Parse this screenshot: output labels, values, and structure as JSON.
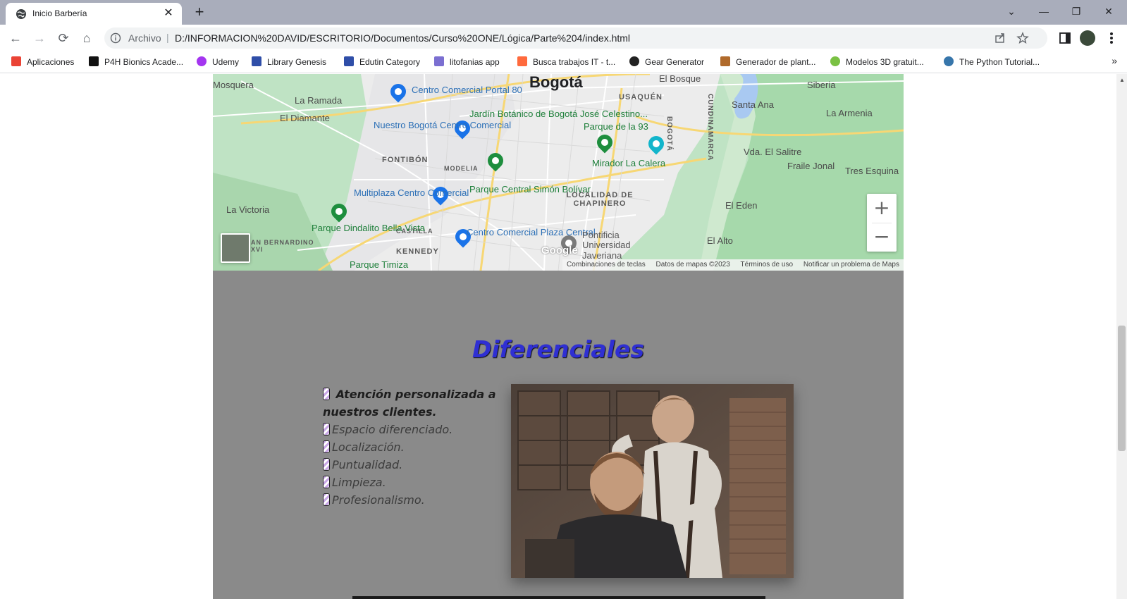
{
  "browser": {
    "tab_title": "Inicio Barbería",
    "tab_close": "✕",
    "new_tab": "+",
    "window_controls": {
      "list_tabs": "⌄",
      "minimize": "—",
      "restore": "❐",
      "close": "✕"
    },
    "nav": {
      "back": "←",
      "forward": "→",
      "reload": "⟳",
      "home": "⌂"
    },
    "address": {
      "scheme_label": "Archivo",
      "separator": "|",
      "url": "D:/INFORMACION%20DAVID/ESCRITORIO/Documentos/Curso%20ONE/Lógica/Parte%204/index.html"
    },
    "bookmarks": [
      {
        "label": "Aplicaciones",
        "icon": "apps-grid-icon",
        "color": "#ea4335"
      },
      {
        "label": "P4H Bionics Acade...",
        "icon": "p4h-icon",
        "color": "#111111"
      },
      {
        "label": "Udemy",
        "icon": "udemy-icon",
        "color": "#a435f0"
      },
      {
        "label": "Library Genesis",
        "icon": "library-icon",
        "color": "#2f4ea8"
      },
      {
        "label": "Edutin Category",
        "icon": "edutin-icon",
        "color": "#2f4ea8"
      },
      {
        "label": "litofanias app",
        "icon": "litofanias-icon",
        "color": "#7b6fd1"
      },
      {
        "label": "Busca trabajos IT - t...",
        "icon": "jobs-icon",
        "color": "#ff6a3d"
      },
      {
        "label": "Gear Generator",
        "icon": "gear-icon",
        "color": "#222222"
      },
      {
        "label": "Generador de plant...",
        "icon": "template-icon",
        "color": "#b06a2b"
      },
      {
        "label": "Modelos 3D gratuit...",
        "icon": "model3d-icon",
        "color": "#7ac143"
      },
      {
        "label": "The Python Tutorial...",
        "icon": "python-icon",
        "color": "#3776ab"
      }
    ],
    "bookmarks_more": "»"
  },
  "map": {
    "city": "Bogotá",
    "labels": {
      "mosquera": "Mosquera",
      "la_ramada": "La Ramada",
      "el_diamante": "El Diamante",
      "fontibon": "FONTIBÓN",
      "modelia": "MODELIA",
      "la_victoria": "La Victoria",
      "san_bernardino": "AN BERNARDINO XVI",
      "castilla": "CASTILLA",
      "kennedy": "KENNEDY",
      "parque_timiza": "Parque Timiza",
      "usaquen": "USAQUÉN",
      "el_bosque": "El Bosque",
      "siberia": "Siberia",
      "santa_ana": "Santa Ana",
      "la_armenia": "La Armenia",
      "vda_el_salitre": "Vda. El Salitre",
      "fraile_jonal": "Fraile Jonal",
      "tres_esquinas": "Tres Esquina",
      "el_eden": "El Eden",
      "el_alto": "El Alto",
      "bogota_vertical": "BOGOTÁ",
      "cundinamarca": "CUNDINAMARCA",
      "localidad": "LOCALIDAD DE CHAPINERO",
      "bogota_top": "Bogotá"
    },
    "pois": {
      "portal80": "Centro Comercial Portal 80",
      "nuestro_bogota": "Nuestro Bogotá Centro Comercial",
      "jardin": "Jardín Botánico de Bogotá José Celestino...",
      "parque93": "Parque de la 93",
      "mirador": "Mirador La Calera",
      "multiplaza": "Multiplaza Centro Comercial",
      "simon_bolivar": "Parque Central Simón Bolívar",
      "dindalito": "Parque Dindalito Bella Vista",
      "plaza_central": "Centro Comercial Plaza Central",
      "javeriana": "Pontificia Universidad Javeriana"
    },
    "zoom_in": "+",
    "zoom_out": "−",
    "google": "Google",
    "attribution": [
      "Combinaciones de teclas",
      "Datos de mapas ©2023",
      "Términos de uso",
      "Notificar un problema de Maps"
    ]
  },
  "section": {
    "title": "Diferenciales",
    "items": [
      "Atención personalizada a nuestros clientes.",
      "Espacio diferenciado.",
      "Localización.",
      "Puntualidad.",
      "Limpieza.",
      "Profesionalismo."
    ]
  }
}
